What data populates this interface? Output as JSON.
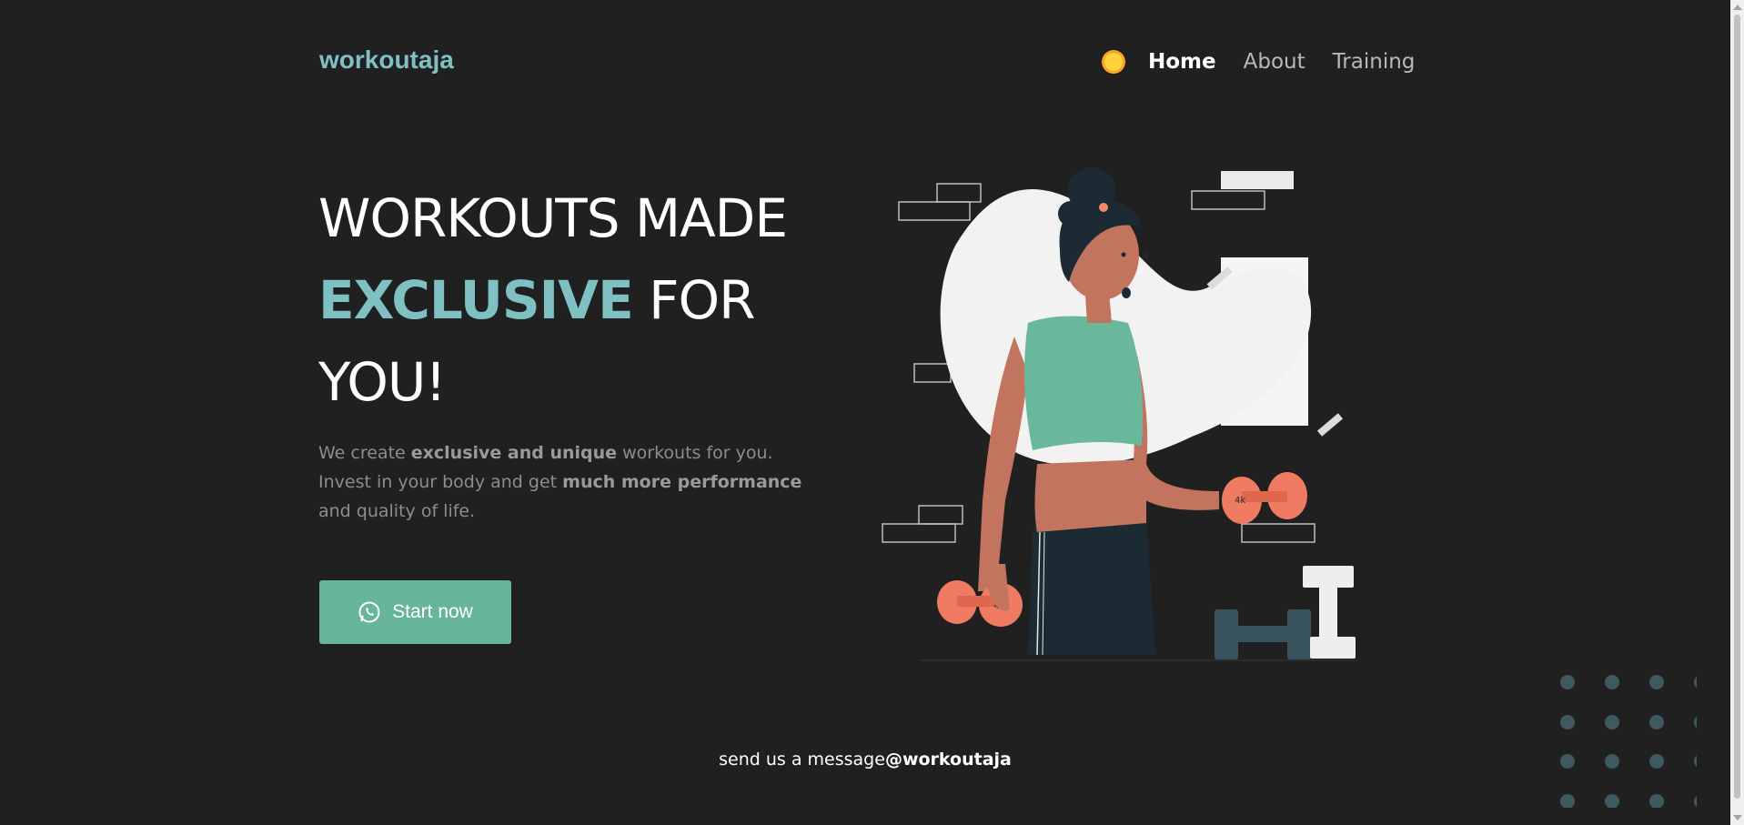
{
  "brand": {
    "logo": "workoutaja"
  },
  "nav": {
    "theme_icon": "sun-icon",
    "items": [
      {
        "label": "Home",
        "active": true
      },
      {
        "label": "About",
        "active": false
      },
      {
        "label": "Training",
        "active": false
      }
    ]
  },
  "hero": {
    "title_line1": "WORKOUTS MADE",
    "title_accent": "EXCLUSIVE",
    "title_after_accent": " FOR",
    "title_line3": "YOU!",
    "desc_part1": "We create ",
    "desc_bold1": "exclusive and unique",
    "desc_part2": " workouts for you. Invest in your body and get ",
    "desc_bold2": "much more performance",
    "desc_part3": " and quality of life.",
    "cta_label": "Start now",
    "cta_icon": "whatsapp-icon"
  },
  "footer": {
    "message": "send us a message",
    "handle": "@workoutaja"
  },
  "colors": {
    "background": "#202020",
    "accent": "#7fc1c3",
    "button": "#67b59c"
  }
}
